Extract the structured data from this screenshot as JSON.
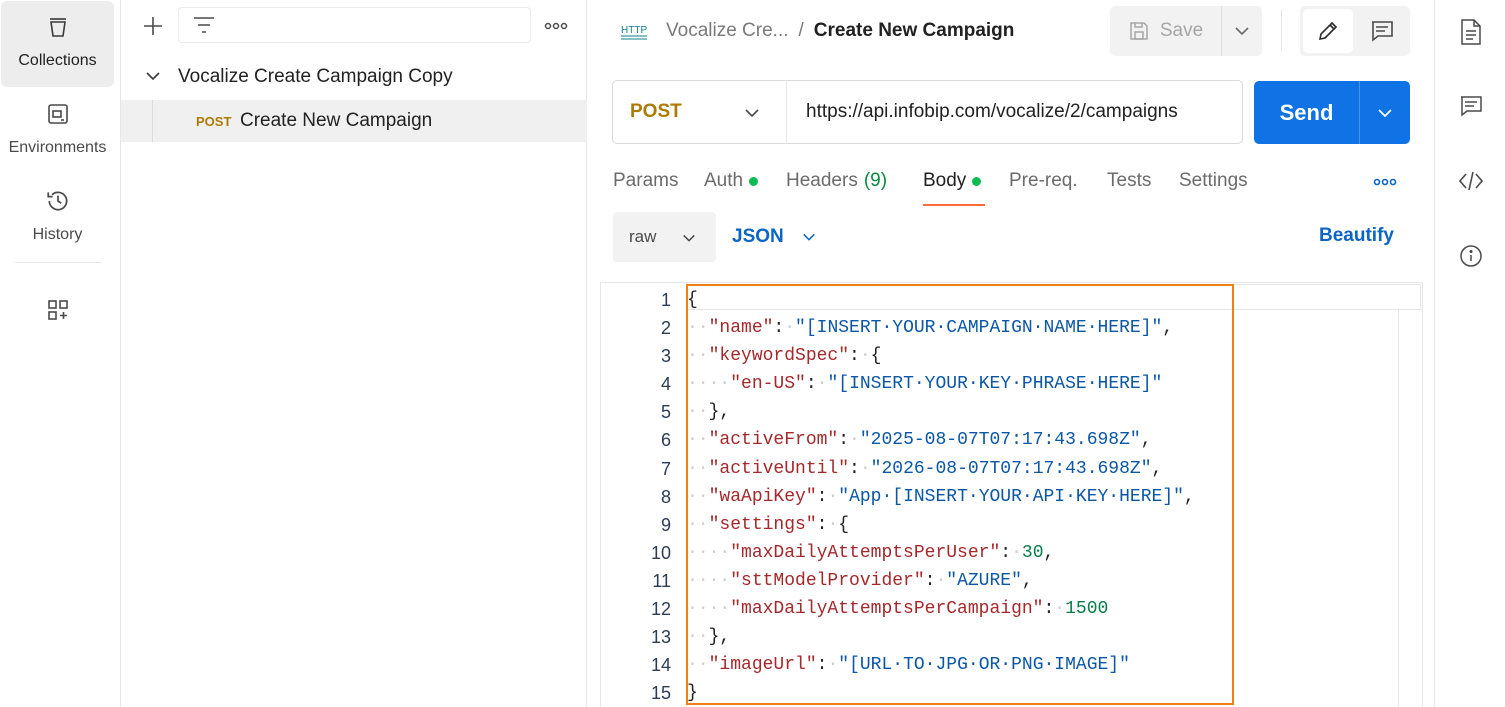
{
  "rail": {
    "collections": "Collections",
    "environments": "Environments",
    "history": "History"
  },
  "sidebar": {
    "collection_name": "Vocalize Create Campaign Copy",
    "request": {
      "method": "POST",
      "name": "Create New Campaign"
    }
  },
  "header": {
    "breadcrumb_parent": "Vocalize Cre...",
    "breadcrumb_separator": "/",
    "title": "Create New Campaign",
    "save_label": "Save"
  },
  "request": {
    "method": "POST",
    "url": "https://api.infobip.com/vocalize/2/campaigns",
    "send_label": "Send"
  },
  "tabs": {
    "params": "Params",
    "auth": "Auth",
    "headers": "Headers",
    "headers_count": "(9)",
    "body": "Body",
    "prereq": "Pre-req.",
    "tests": "Tests",
    "settings": "Settings"
  },
  "body": {
    "mode": "raw",
    "format": "JSON",
    "beautify_label": "Beautify"
  },
  "editor": {
    "line_numbers": [
      "1",
      "2",
      "3",
      "4",
      "5",
      "6",
      "7",
      "8",
      "9",
      "10",
      "11",
      "12",
      "13",
      "14",
      "15"
    ],
    "lines": [
      [
        [
          "p",
          "{"
        ]
      ],
      [
        [
          "w",
          "··"
        ],
        [
          "k",
          "\"name\""
        ],
        [
          "p",
          ":"
        ],
        [
          "w",
          "·"
        ],
        [
          "s",
          "\"[INSERT·YOUR·CAMPAIGN·NAME·HERE]\""
        ],
        [
          "p",
          ","
        ]
      ],
      [
        [
          "w",
          "··"
        ],
        [
          "k",
          "\"keywordSpec\""
        ],
        [
          "p",
          ":"
        ],
        [
          "w",
          "·"
        ],
        [
          "p",
          "{"
        ]
      ],
      [
        [
          "w",
          "····"
        ],
        [
          "k",
          "\"en-US\""
        ],
        [
          "p",
          ":"
        ],
        [
          "w",
          "·"
        ],
        [
          "s",
          "\"[INSERT·YOUR·KEY·PHRASE·HERE]\""
        ]
      ],
      [
        [
          "w",
          "··"
        ],
        [
          "p",
          "},"
        ]
      ],
      [
        [
          "w",
          "··"
        ],
        [
          "k",
          "\"activeFrom\""
        ],
        [
          "p",
          ":"
        ],
        [
          "w",
          "·"
        ],
        [
          "s",
          "\"2025-08-07T07:17:43.698Z\""
        ],
        [
          "p",
          ","
        ]
      ],
      [
        [
          "w",
          "··"
        ],
        [
          "k",
          "\"activeUntil\""
        ],
        [
          "p",
          ":"
        ],
        [
          "w",
          "·"
        ],
        [
          "s",
          "\"2026-08-07T07:17:43.698Z\""
        ],
        [
          "p",
          ","
        ]
      ],
      [
        [
          "w",
          "··"
        ],
        [
          "k",
          "\"waApiKey\""
        ],
        [
          "p",
          ":"
        ],
        [
          "w",
          "·"
        ],
        [
          "s",
          "\"App·[INSERT·YOUR·API·KEY·HERE]\""
        ],
        [
          "p",
          ","
        ]
      ],
      [
        [
          "w",
          "··"
        ],
        [
          "k",
          "\"settings\""
        ],
        [
          "p",
          ":"
        ],
        [
          "w",
          "·"
        ],
        [
          "p",
          "{"
        ]
      ],
      [
        [
          "w",
          "····"
        ],
        [
          "k",
          "\"maxDailyAttemptsPerUser\""
        ],
        [
          "p",
          ":"
        ],
        [
          "w",
          "·"
        ],
        [
          "n",
          "30"
        ],
        [
          "p",
          ","
        ]
      ],
      [
        [
          "w",
          "····"
        ],
        [
          "k",
          "\"sttModelProvider\""
        ],
        [
          "p",
          ":"
        ],
        [
          "w",
          "·"
        ],
        [
          "s",
          "\"AZURE\""
        ],
        [
          "p",
          ","
        ]
      ],
      [
        [
          "w",
          "····"
        ],
        [
          "k",
          "\"maxDailyAttemptsPerCampaign\""
        ],
        [
          "p",
          ":"
        ],
        [
          "w",
          "·"
        ],
        [
          "n",
          "1500"
        ]
      ],
      [
        [
          "w",
          "··"
        ],
        [
          "p",
          "},"
        ]
      ],
      [
        [
          "w",
          "··"
        ],
        [
          "k",
          "\"imageUrl\""
        ],
        [
          "p",
          ":"
        ],
        [
          "w",
          "·"
        ],
        [
          "s",
          "\"[URL·TO·JPG·OR·PNG·IMAGE]\""
        ]
      ],
      [
        [
          "p",
          "}"
        ]
      ]
    ]
  },
  "colors": {
    "accent_send": "#0f72e5",
    "method_post": "#ad7a03",
    "active_tab_underline": "#ff6c37",
    "status_dot": "#0cbb52",
    "highlight_box": "#f08010"
  },
  "icons": [
    "collections-icon",
    "environments-icon",
    "history-icon",
    "add-workspace-icon",
    "plus-icon",
    "filter-icon",
    "more-icon",
    "chevron-down-icon",
    "http-icon",
    "save-icon",
    "pencil-icon",
    "comment-icon",
    "document-icon",
    "code-icon",
    "info-icon"
  ]
}
